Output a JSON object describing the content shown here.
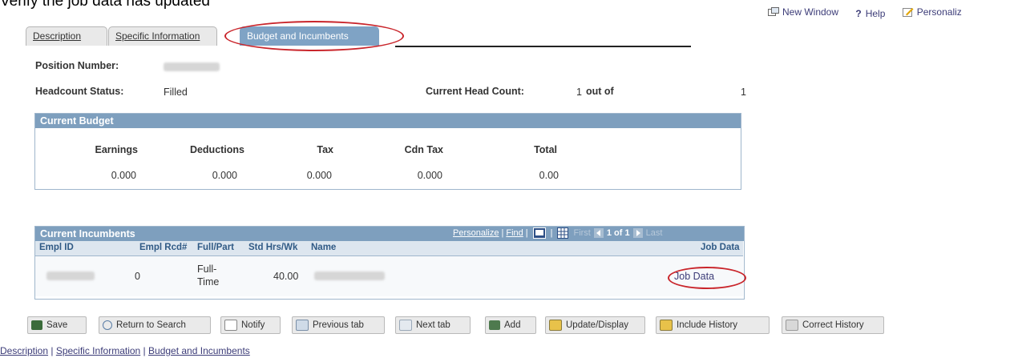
{
  "caption": "Verify the job data has updated",
  "toplinks": {
    "new_window": "New Window",
    "help": "Help",
    "personalize": "Personaliz"
  },
  "tabs": [
    {
      "label": "Description"
    },
    {
      "label": "Specific Information"
    },
    {
      "label": "Budget and Incumbents",
      "active": true
    }
  ],
  "position": {
    "number_label": "Position Number:",
    "headcount_label": "Headcount Status:",
    "headcount_value": "Filled",
    "current_head_count_label": "Current Head Count:",
    "current_head_count_value": "1",
    "out_of_label": "out of",
    "out_of_value": "1"
  },
  "budget": {
    "title": "Current Budget",
    "headers": [
      "Earnings",
      "Deductions",
      "Tax",
      "Cdn Tax",
      "Total"
    ],
    "values": [
      "0.000",
      "0.000",
      "0.000",
      "0.000",
      "0.00"
    ]
  },
  "incumbents": {
    "title": "Current Incumbents",
    "personalize": "Personalize",
    "find": "Find",
    "first": "First",
    "range": "1 of 1",
    "last": "Last",
    "columns": [
      "Empl ID",
      "Empl Rcd#",
      "Full/Part",
      "Std Hrs/Wk",
      "Name",
      "Job Data"
    ],
    "rows": [
      {
        "empl_rcd": "0",
        "full_part_1": "Full-",
        "full_part_2": "Time",
        "std_hrs": "40.00",
        "job_data": "Job Data"
      }
    ]
  },
  "buttons": {
    "save": "Save",
    "return_to_search": "Return to Search",
    "notify": "Notify",
    "previous_tab": "Previous tab",
    "next_tab": "Next tab",
    "add": "Add",
    "update_display": "Update/Display",
    "include_history": "Include History",
    "correct_history": "Correct History"
  },
  "footer": {
    "description": "Description",
    "specific_information": "Specific Information",
    "budget_and_incumbents": "Budget and Incumbents",
    "separator": " | "
  },
  "colors": {
    "header_blue": "#7e9fbe",
    "tab_active": "#7fa3c5",
    "annotation_red": "#c9252b",
    "link": "#3c3c78"
  }
}
